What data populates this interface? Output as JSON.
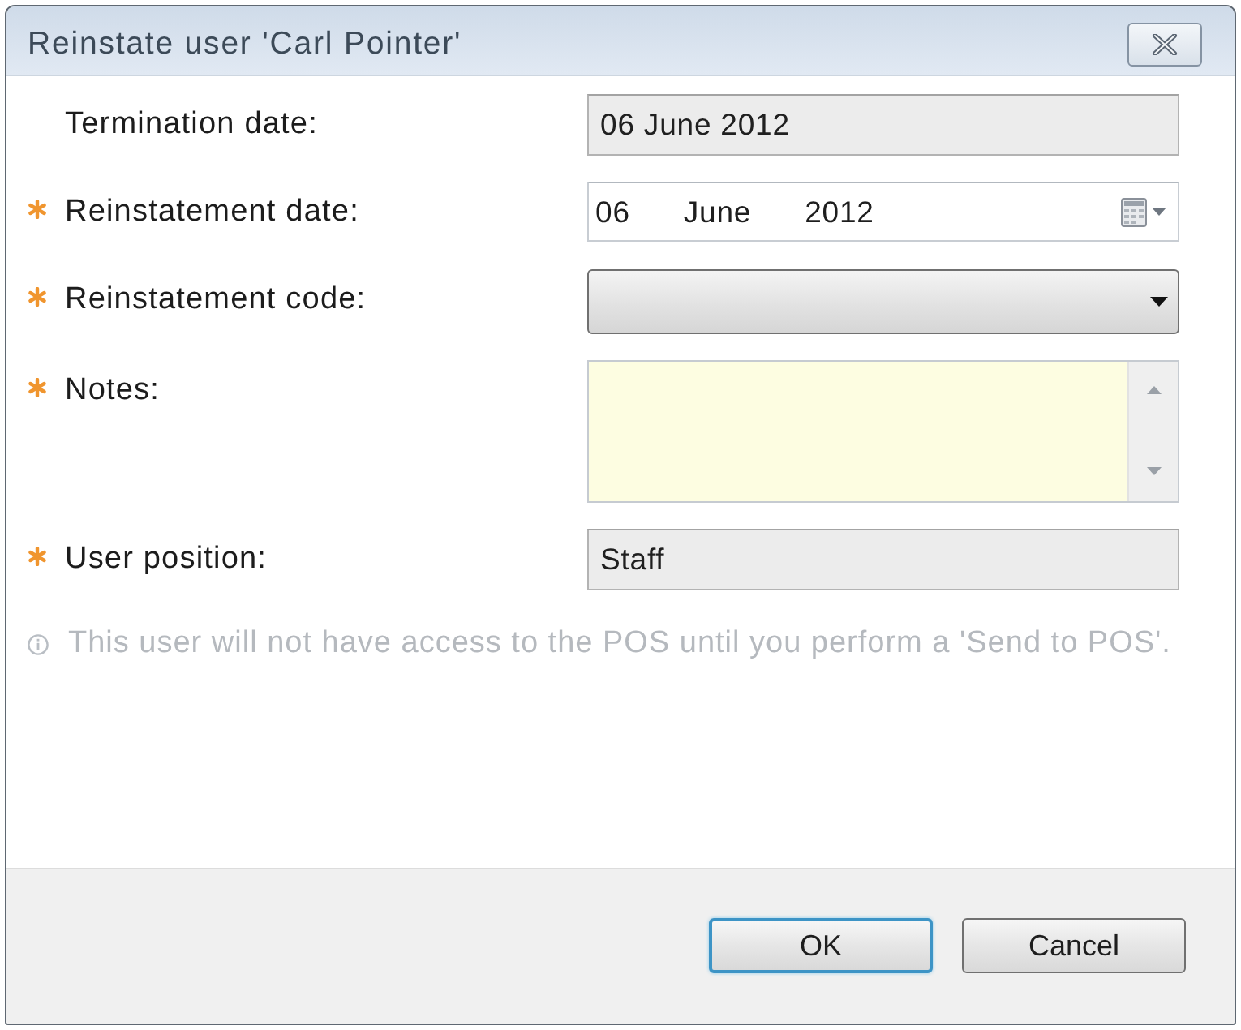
{
  "window": {
    "title": "Reinstate user 'Carl Pointer'"
  },
  "form": {
    "fields": [
      {
        "kind": "readonly",
        "label": "Termination date:",
        "required": false,
        "value": "06 June 2012"
      },
      {
        "kind": "date",
        "label": "Reinstatement date:",
        "required": true,
        "parts": [
          "06",
          "June",
          "2012"
        ]
      },
      {
        "kind": "dropdown",
        "label": "Reinstatement code:",
        "required": true
      },
      {
        "kind": "textarea",
        "label": "Notes:",
        "required": true
      },
      {
        "kind": "readonly",
        "label": "User position:",
        "required": true,
        "value": "Staff"
      }
    ]
  },
  "info": "This user will not have access to the POS until you perform a 'Send to POS'.",
  "buttons": [
    {
      "label": "OK",
      "default": true
    },
    {
      "label": "Cancel",
      "default": false
    }
  ]
}
